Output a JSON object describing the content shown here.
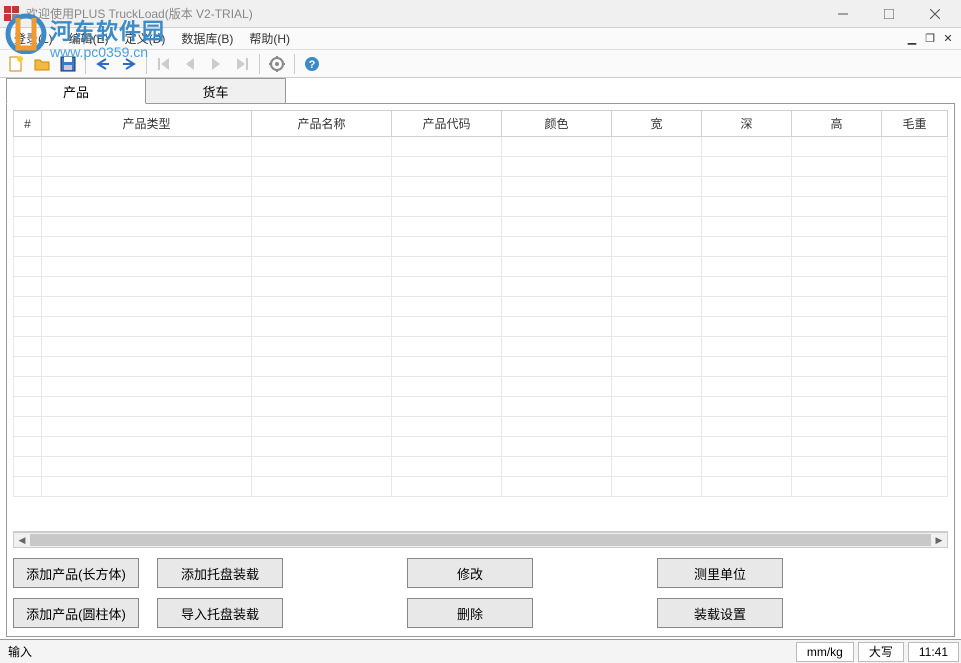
{
  "window": {
    "title": "欢迎使用PLUS TruckLoad(版本 V2-TRIAL)"
  },
  "watermark": {
    "text": "河东软件园",
    "url": "www.pc0359.cn"
  },
  "menu": {
    "login": "登录(L)",
    "edit": "编辑(E)",
    "define": "定义(D)",
    "database": "数据库(B)",
    "help": "帮助(H)"
  },
  "tabs": {
    "product": "产品",
    "truck": "货车"
  },
  "columns": {
    "num": "#",
    "type": "产品类型",
    "name": "产品名称",
    "code": "产品代码",
    "color": "颜色",
    "width": "宽",
    "depth": "深",
    "height": "高",
    "weight": "毛重"
  },
  "buttons": {
    "add_cuboid": "添加产品(长方体)",
    "add_pallet": "添加托盘装载",
    "modify": "修改",
    "unit": "测里单位",
    "add_cylinder": "添加产品(圆柱体)",
    "import_pallet": "导入托盘装载",
    "delete": "删除",
    "load_setting": "装载设置"
  },
  "status": {
    "input": "输入",
    "unit": "mm/kg",
    "caps": "大写",
    "time": "11:41"
  }
}
